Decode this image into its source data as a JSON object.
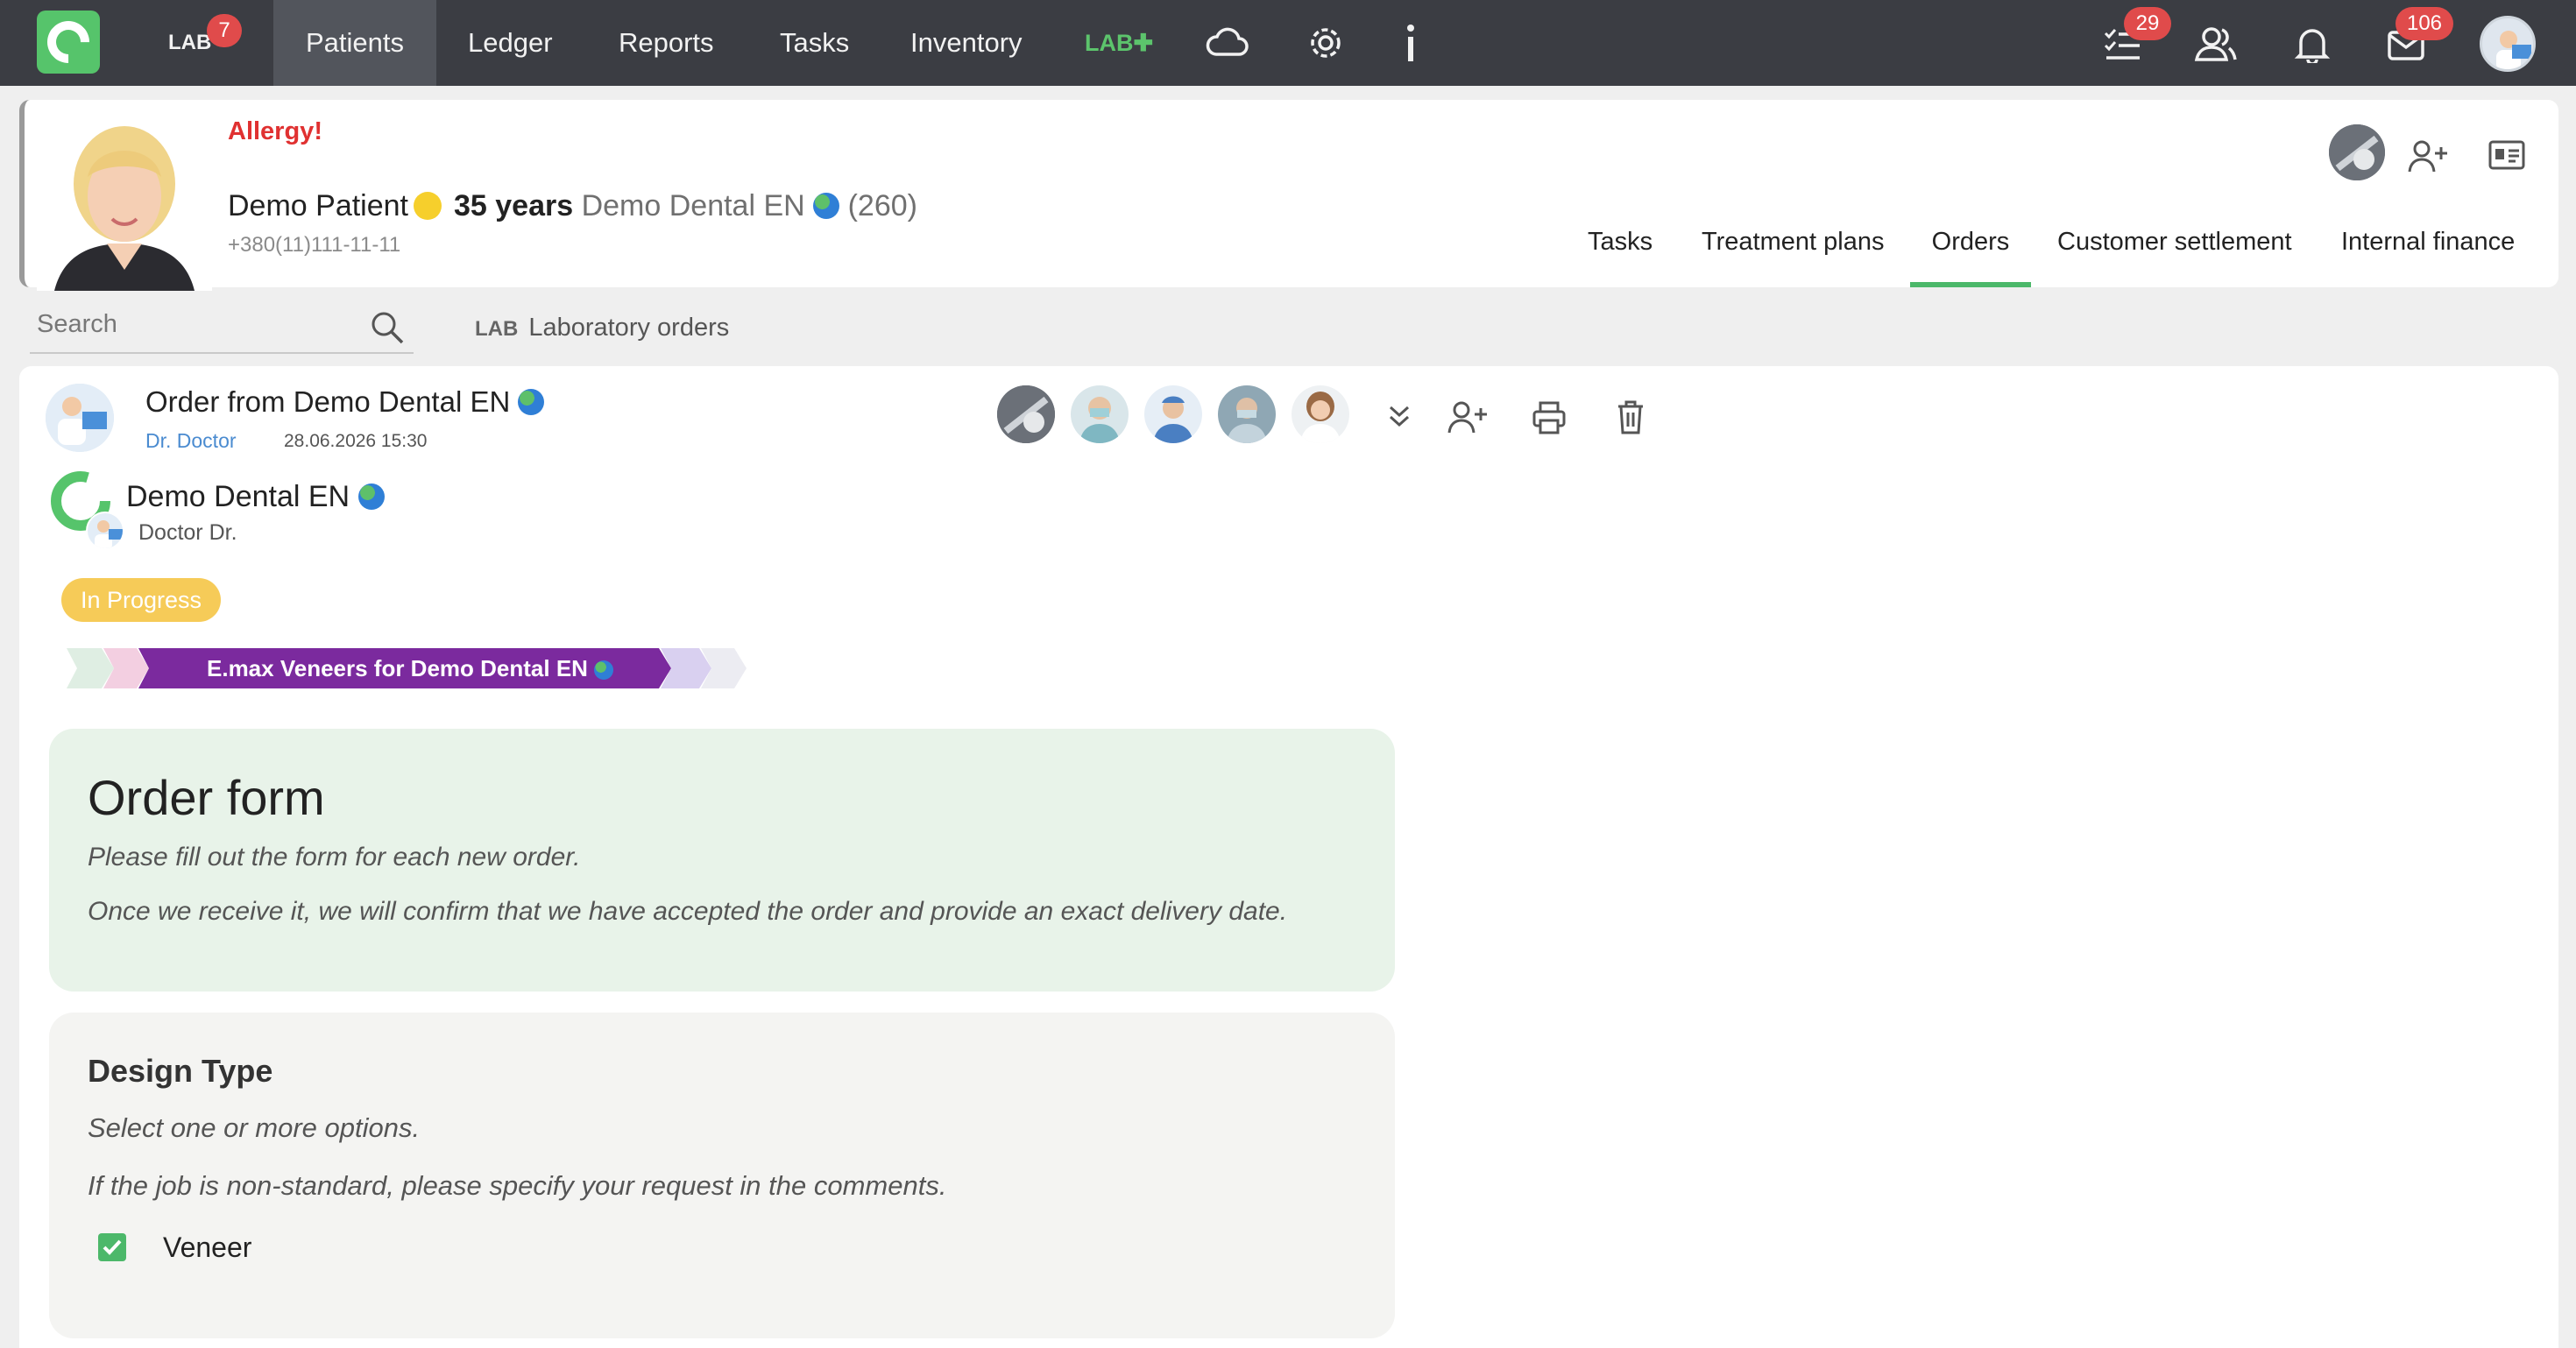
{
  "nav": {
    "lab_label": "LAB",
    "lab_badge": "7",
    "items": [
      "Patients",
      "Ledger",
      "Reports",
      "Tasks",
      "Inventory"
    ],
    "labplus": "LAB",
    "tasks_badge": "29",
    "messages_badge": "106"
  },
  "patient": {
    "allergy": "Allergy!",
    "name": "Demo Patient",
    "age": "35 years",
    "clinic": "Demo Dental EN",
    "count": "(260)",
    "phone": "+380(11)111-11-11",
    "tabs": [
      "Tasks",
      "Treatment plans",
      "Orders",
      "Customer settlement",
      "Internal finance"
    ],
    "active_tab": "Orders"
  },
  "search": {
    "placeholder": "Search"
  },
  "section": {
    "tag": "LAB",
    "title": "Laboratory orders"
  },
  "order": {
    "title": "Order from Demo Dental EN",
    "doctor": "Dr. Doctor",
    "date": "28.06.2026 15:30",
    "lab_name": "Demo Dental EN",
    "lab_doctor": "Doctor Dr.",
    "status": "In Progress",
    "stage_label": "E.max Veneers for Demo Dental EN"
  },
  "form": {
    "title": "Order form",
    "line1": "Please fill out the form for each new order.",
    "line2": "Once we receive it, we will confirm that we have accepted the order and provide an exact delivery date."
  },
  "design": {
    "title": "Design Type",
    "line1": "Select one or more options.",
    "line2": "If the job is non-standard, please specify your request in the comments.",
    "option": "Veneer",
    "option_checked": true
  },
  "colors": {
    "nav_bg": "#3b3d43",
    "accent_green": "#4cb86a",
    "badge_red": "#e04b4b",
    "status_yellow": "#f6cb58",
    "stage_purple": "#7b2a9e"
  }
}
